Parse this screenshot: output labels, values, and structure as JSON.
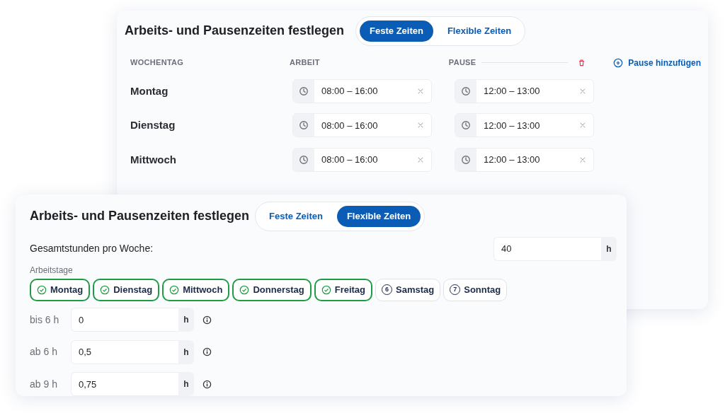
{
  "back_card": {
    "title": "Arbeits- und Pausenzeiten festlegen",
    "tabs": [
      {
        "label": "Feste Zeiten",
        "selected": true
      },
      {
        "label": "Flexible Zeiten",
        "selected": false
      }
    ],
    "columns": [
      "WOCHENTAG",
      "ARBEIT",
      "PAUSE"
    ],
    "add_break_link": "Pause hinzufügen",
    "rows": [
      {
        "day": "Montag",
        "work": "08:00 – 16:00",
        "break": "12:00 – 13:00"
      },
      {
        "day": "Dienstag",
        "work": "08:00 – 16:00",
        "break": "12:00 – 13:00"
      },
      {
        "day": "Mittwoch",
        "work": "08:00 – 16:00",
        "break": "12:00 – 13:00"
      }
    ]
  },
  "front_card": {
    "title": "Arbeits- und Pausenzeiten festlegen",
    "tabs": [
      {
        "label": "Feste Zeiten",
        "selected": false
      },
      {
        "label": "Flexible Zeiten",
        "selected": true
      }
    ],
    "weekly_hours": {
      "label": "Gesamtstunden pro Woche:",
      "value": "40",
      "unit": "h"
    },
    "workdays": {
      "label": "Arbeitstage",
      "days": [
        {
          "label": "Montag",
          "selected": true
        },
        {
          "label": "Dienstag",
          "selected": true
        },
        {
          "label": "Mittwoch",
          "selected": true
        },
        {
          "label": "Donnerstag",
          "selected": true
        },
        {
          "label": "Freitag",
          "selected": true
        },
        {
          "label": "Samstag",
          "number": "6",
          "selected": false
        },
        {
          "label": "Sonntag",
          "number": "7",
          "selected": false
        }
      ]
    },
    "break_rules": [
      {
        "label": "bis 6 h",
        "value": "0",
        "unit": "h"
      },
      {
        "label": "ab 6 h",
        "value": "0,5",
        "unit": "h"
      },
      {
        "label": "ab 9 h",
        "value": "0,75",
        "unit": "h"
      }
    ]
  }
}
